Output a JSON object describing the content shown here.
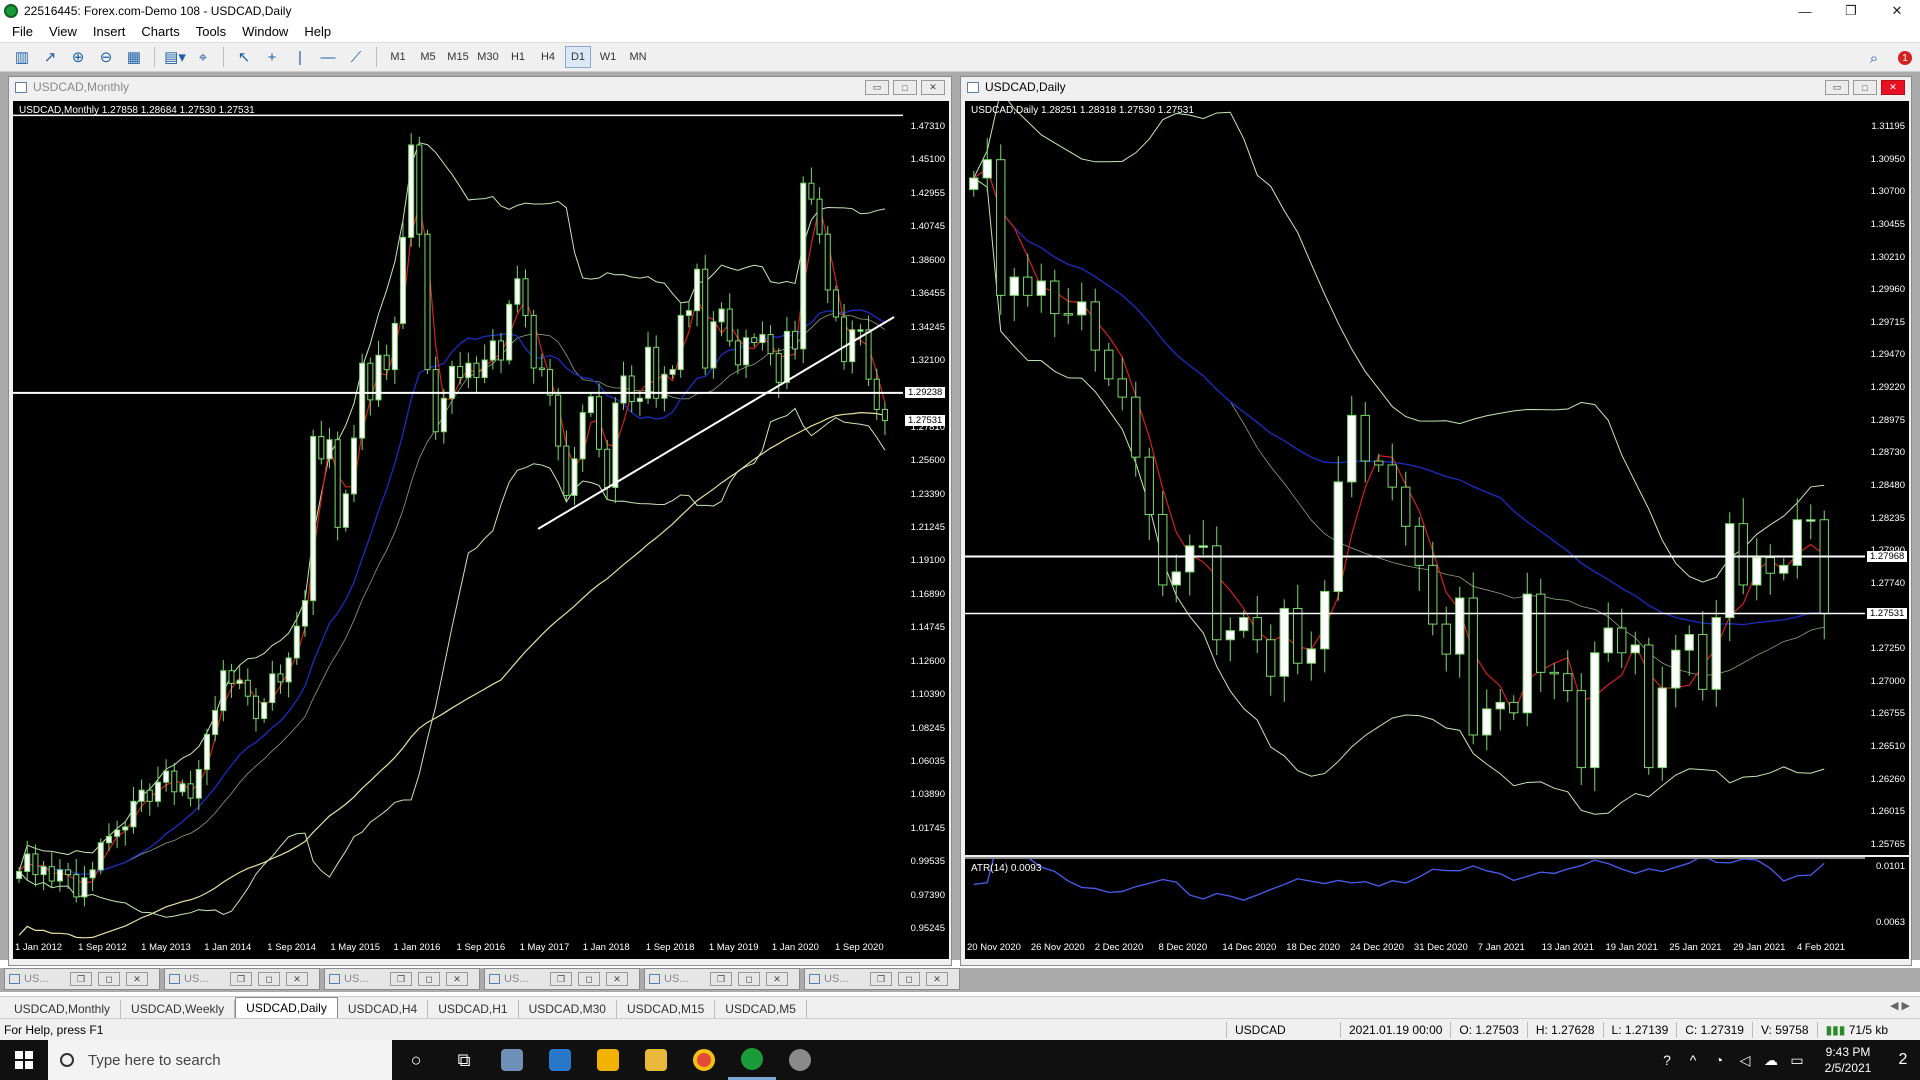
{
  "window": {
    "title": "22516445: Forex.com-Demo 108 - USDCAD,Daily",
    "minimize": "—",
    "restore": "❐",
    "close": "✕"
  },
  "menu": [
    "File",
    "View",
    "Insert",
    "Charts",
    "Tools",
    "Window",
    "Help"
  ],
  "toolbar": {
    "timeframes": [
      "M1",
      "M5",
      "M15",
      "M30",
      "H1",
      "H4",
      "D1",
      "W1",
      "MN"
    ],
    "active_timeframe": "D1",
    "alert_count": "1"
  },
  "colors": {
    "chart_bg": "#000000",
    "candle_bull": "#ffffff",
    "candle_wick": "#7bd96a",
    "ma_fast": "#d42020",
    "ma_slow": "#1c2cc4",
    "bands": "#c8e6b4",
    "long_ma": "#e8e0a0",
    "atr": "#4a5cf0"
  },
  "monthly_window": {
    "title": "USDCAD,Monthly",
    "info": "USDCAD,Monthly  1.27858 1.28684 1.27530 1.27531",
    "price_badge": "1.27531",
    "line_badge": "1.29238"
  },
  "daily_window": {
    "title": "USDCAD,Daily",
    "info": "USDCAD,Daily  1.28251 1.28318 1.27530 1.27531",
    "price_badge": "1.27531",
    "line_badge": "1.27968",
    "atr_label": "ATR(14) 0.0093"
  },
  "chart_data": [
    {
      "type": "candlestick",
      "name": "USDCAD,Monthly",
      "y_ticks": [
        "1.47310",
        "1.45100",
        "1.42955",
        "1.40745",
        "1.38600",
        "1.36455",
        "1.34245",
        "1.32100",
        "1.29955",
        "1.27810",
        "1.25600",
        "1.23390",
        "1.21245",
        "1.19100",
        "1.16890",
        "1.14745",
        "1.12600",
        "1.10390",
        "1.08245",
        "1.06035",
        "1.03890",
        "1.01745",
        "0.99535",
        "0.97390",
        "0.95245"
      ],
      "ylim": [
        0.9496,
        1.4756
      ],
      "x_ticks": [
        "1 Jan 2012",
        "1 Sep 2012",
        "1 May 2013",
        "1 Jan 2014",
        "1 Sep 2014",
        "1 May 2015",
        "1 Jan 2016",
        "1 Sep 2016",
        "1 May 2017",
        "1 Jan 2018",
        "1 Sep 2018",
        "1 May 2019",
        "1 Jan 2020",
        "1 Sep 2020"
      ],
      "close": [
        0.992,
        1.003,
        0.99,
        0.995,
        0.986,
        0.993,
        0.99,
        0.976,
        0.988,
        0.993,
        1.01,
        1.014,
        1.018,
        1.02,
        1.036,
        1.043,
        1.036,
        1.048,
        1.055,
        1.042,
        1.047,
        1.038,
        1.056,
        1.078,
        1.093,
        1.118,
        1.11,
        1.112,
        1.102,
        1.088,
        1.098,
        1.116,
        1.111,
        1.126,
        1.146,
        1.162,
        1.265,
        1.251,
        1.263,
        1.208,
        1.229,
        1.264,
        1.311,
        1.288,
        1.316,
        1.307,
        1.336,
        1.39,
        1.448,
        1.392,
        1.307,
        1.268,
        1.289,
        1.309,
        1.302,
        1.311,
        1.302,
        1.313,
        1.325,
        1.313,
        1.348,
        1.364,
        1.341,
        1.308,
        1.307,
        1.291,
        1.259,
        1.228,
        1.251,
        1.28,
        1.29,
        1.257,
        1.233,
        1.286,
        1.303,
        1.287,
        1.289,
        1.321,
        1.289,
        1.304,
        1.307,
        1.341,
        1.344,
        1.37,
        1.308,
        1.337,
        1.345,
        1.325,
        1.31,
        1.327,
        1.324,
        1.329,
        1.317,
        1.299,
        1.331,
        1.32,
        1.424,
        1.414,
        1.392,
        1.357,
        1.34,
        1.312,
        1.332,
        1.332,
        1.301,
        1.282,
        1.275
      ],
      "series": [
        {
          "name": "",
          "description": "fast moving average (red)"
        },
        {
          "name": "",
          "description": "slow moving average (blue)"
        },
        {
          "name": "",
          "description": "bands (light green)"
        },
        {
          "name": "",
          "description": "long moving average (cream)"
        }
      ],
      "horizontal_lines": [
        1.2924,
        1.4666
      ],
      "trendline": [
        [
          0.59,
          1.207
        ],
        [
          0.99,
          1.34
        ]
      ]
    },
    {
      "type": "candlestick",
      "name": "USDCAD,Daily",
      "y_ticks": [
        "1.31195",
        "1.30950",
        "1.30700",
        "1.30455",
        "1.30210",
        "1.29960",
        "1.29715",
        "1.29470",
        "1.29220",
        "1.28975",
        "1.28730",
        "1.28480",
        "1.28235",
        "1.27990",
        "1.27740",
        "1.27495",
        "1.27250",
        "1.27000",
        "1.26755",
        "1.26510",
        "1.26260",
        "1.26015",
        "1.25765"
      ],
      "ylim": [
        1.2568,
        1.3146
      ],
      "x_ticks": [
        "20 Nov 2020",
        "26 Nov 2020",
        "2 Dec 2020",
        "8 Dec 2020",
        "14 Dec 2020",
        "18 Dec 2020",
        "24 Dec 2020",
        "31 Dec 2020",
        "7 Jan 2021",
        "13 Jan 2021",
        "19 Jan 2021",
        "25 Jan 2021",
        "29 Jan 2021",
        "4 Feb 2021"
      ],
      "close": [
        1.3087,
        1.3101,
        1.2997,
        1.3011,
        1.2997,
        1.3008,
        1.2983,
        1.2982,
        1.2992,
        1.2955,
        1.2933,
        1.2919,
        1.2873,
        1.2829,
        1.2775,
        1.2785,
        1.2805,
        1.2805,
        1.2733,
        1.274,
        1.275,
        1.2733,
        1.2705,
        1.2757,
        1.2715,
        1.2726,
        1.277,
        1.2854,
        1.2905,
        1.287,
        1.2867,
        1.285,
        1.282,
        1.279,
        1.2745,
        1.2722,
        1.2765,
        1.266,
        1.268,
        1.2685,
        1.2677,
        1.2768,
        1.2708,
        1.2707,
        1.2694,
        1.2635,
        1.2723,
        1.2742,
        1.2723,
        1.2729,
        1.2635,
        1.2696,
        1.2725,
        1.2737,
        1.2695,
        1.275,
        1.2822,
        1.2775,
        1.2796,
        1.2784,
        1.279,
        1.2825,
        1.2825,
        1.2753
      ],
      "series": [
        {
          "name": "",
          "description": "fast moving average (red)"
        },
        {
          "name": "",
          "description": "slow moving average (blue)"
        },
        {
          "name": "",
          "description": "bands (light green)"
        }
      ],
      "horizontal_lines": [
        1.27968,
        1.27531
      ],
      "atr": {
        "label": "ATR(14) 0.0093",
        "y_ticks": [
          "0.0101",
          "0.0063"
        ]
      }
    }
  ],
  "minimized": [
    {
      "label": "US...",
      "btn1": "❐",
      "btn2": "◻",
      "btn3": "✕"
    },
    {
      "label": "US...",
      "btn1": "❐",
      "btn2": "◻",
      "btn3": "✕"
    },
    {
      "label": "US...",
      "btn1": "❐",
      "btn2": "◻",
      "btn3": "✕"
    },
    {
      "label": "US...",
      "btn1": "❐",
      "btn2": "◻",
      "btn3": "✕"
    },
    {
      "label": "US...",
      "btn1": "❐",
      "btn2": "◻",
      "btn3": "✕"
    },
    {
      "label": "US...",
      "btn1": "❐",
      "btn2": "◻",
      "btn3": "✕"
    }
  ],
  "tabs": [
    "USDCAD,Monthly",
    "USDCAD,Weekly",
    "USDCAD,Daily",
    "USDCAD,H4",
    "USDCAD,H1",
    "USDCAD,M30",
    "USDCAD,M15",
    "USDCAD,M5"
  ],
  "active_tab": "USDCAD,Daily",
  "status": {
    "help": "For Help, press F1",
    "symbol": "USDCAD",
    "datetime": "2021.01.19 00:00",
    "open": "O: 1.27503",
    "high": "H: 1.27628",
    "low": "L: 1.27139",
    "close": "C: 1.27319",
    "volume": "V: 59758",
    "traffic": "71/5 kb"
  },
  "taskbar": {
    "search_placeholder": "Type here to search",
    "time": "9:43 PM",
    "date": "2/5/2021",
    "notif_count": "2"
  }
}
